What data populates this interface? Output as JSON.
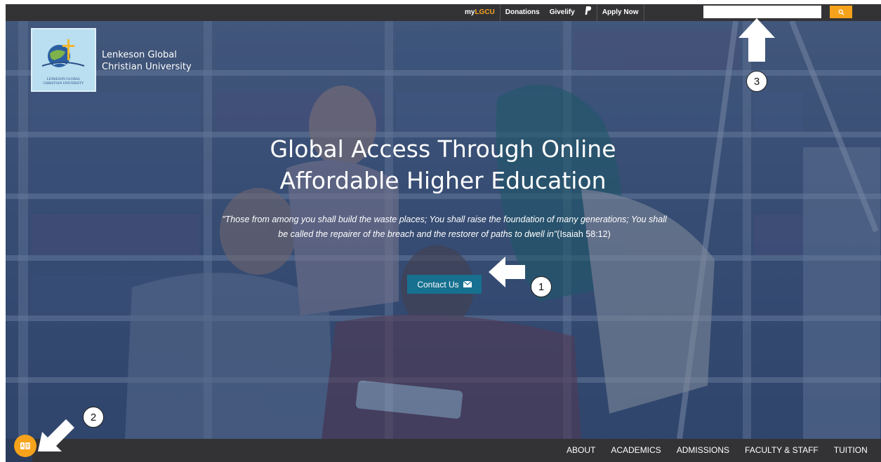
{
  "topbar": {
    "mylgcu_prefix": "my",
    "mylgcu_suffix": "LGCU",
    "donations": "Donations",
    "givelify": "Givelify",
    "paypal_icon": "paypal-icon",
    "apply_now": "Apply Now",
    "search_value": "",
    "search_icon": "search-icon"
  },
  "brand": {
    "line1": "Lenkeson Global",
    "line2": "Christian University",
    "logo_caption_line1": "LENKESON GLOBAL",
    "logo_caption_line2": "CHRISTIAN UNIVERSITY"
  },
  "hero": {
    "headline_line1": "Global Access Through Online",
    "headline_line2": "Affordable Higher Education",
    "quote": "\"Those from among you shall build the waste places; You shall raise the foundation of many generations; You shall be called the repairer of the breach and the restorer of paths to dwell in\"",
    "citation": "(Isaiah 58:12)",
    "contact_label": "Contact Us",
    "contact_icon": "envelope-icon"
  },
  "annotations": [
    "1",
    "2",
    "3"
  ],
  "bottomnav": {
    "items": [
      "ABOUT",
      "ACADEMICS",
      "ADMISSIONS",
      "FACULTY & STAFF",
      "TUITION"
    ]
  },
  "accessibility": {
    "icon": "translate-icon"
  },
  "colors": {
    "accent": "#f6a21b",
    "bar": "#333336",
    "button": "#17708f"
  }
}
